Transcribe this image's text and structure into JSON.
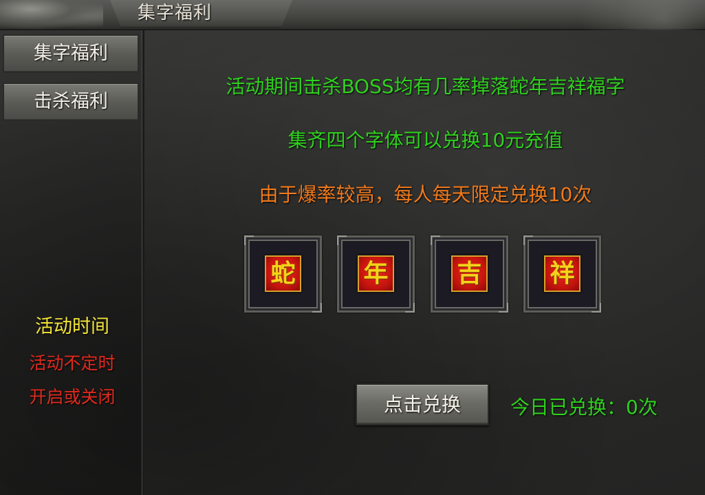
{
  "window": {
    "title": "集字福利"
  },
  "sidebar": {
    "items": [
      {
        "label": "集字福利"
      },
      {
        "label": "击杀福利"
      }
    ],
    "event_time_label": "活动时间",
    "event_time_note_1": "活动不定时",
    "event_time_note_2": "开启或关闭"
  },
  "main": {
    "line_1": "活动期间击杀BOSS均有几率掉落蛇年吉祥福字",
    "line_2": "集齐四个字体可以兑换10元充值",
    "line_3": "由于爆率较高，每人每天限定兑换10次",
    "tiles": [
      {
        "char": "蛇"
      },
      {
        "char": "年"
      },
      {
        "char": "吉"
      },
      {
        "char": "祥"
      }
    ],
    "exchange_button": "点击兑换",
    "exchanged_today": "今日已兑换：0次"
  },
  "colors": {
    "green_text": "#2fd11e",
    "orange_text": "#f07a1c",
    "yellow_text": "#f2e43a",
    "red_text": "#e02a1e",
    "tile_red": "#c8150f",
    "tile_gold": "#f5d21a"
  }
}
